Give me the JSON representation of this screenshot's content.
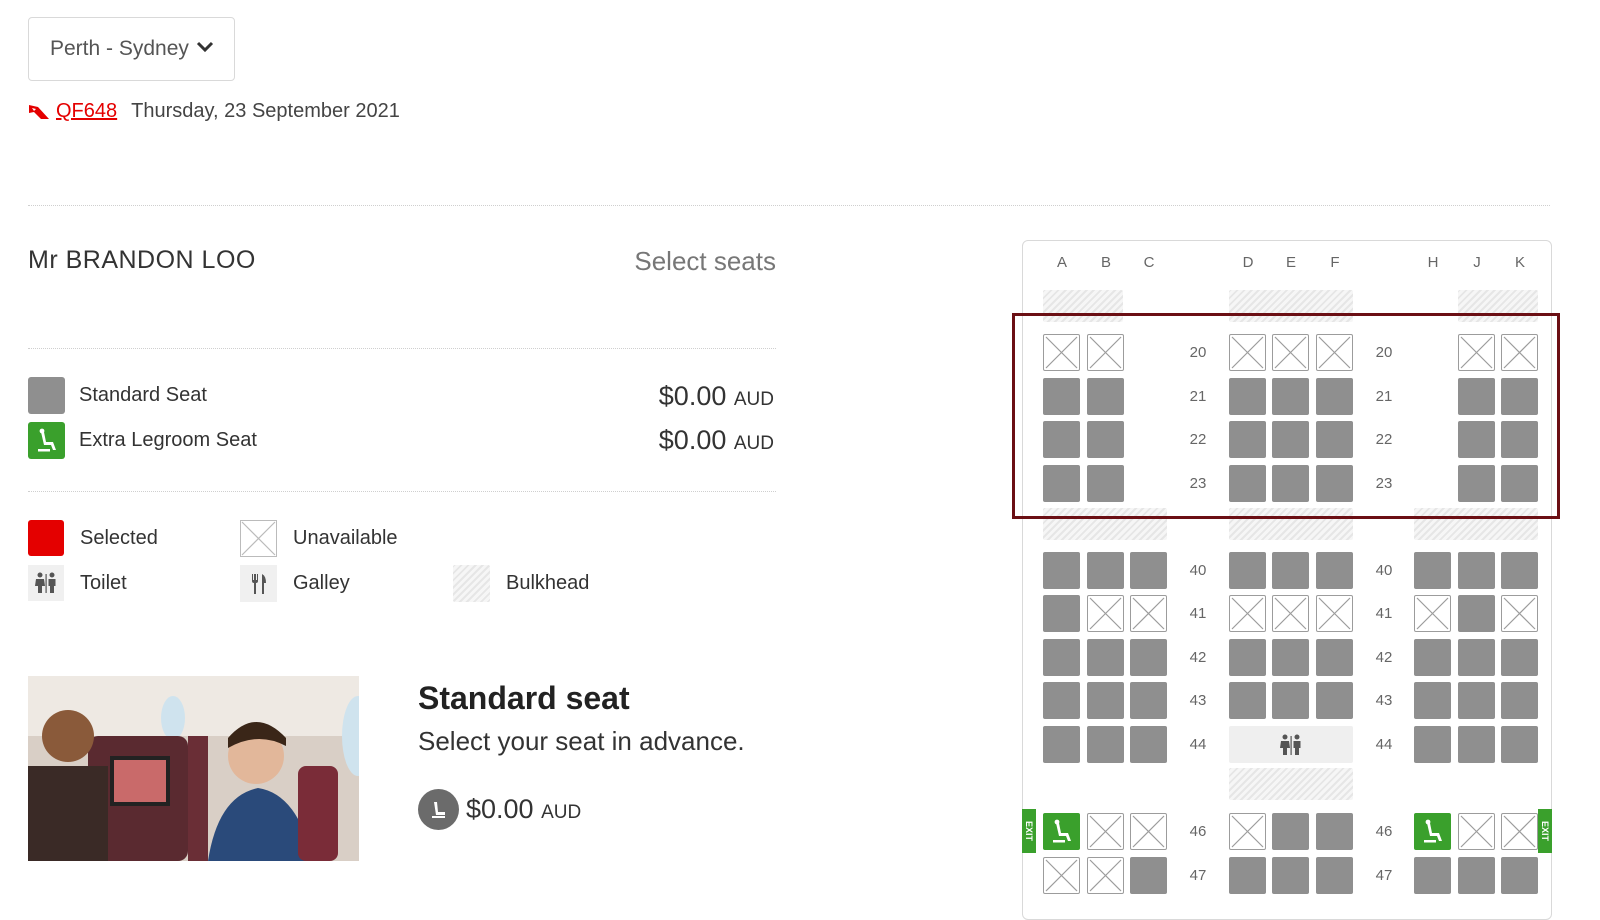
{
  "route": {
    "selected": "Perth - Sydney"
  },
  "flight": {
    "number": "QF648",
    "date": "Thursday, 23 September 2021"
  },
  "passenger": {
    "name": "Mr BRANDON LOO",
    "action_label": "Select seats"
  },
  "seat_types": [
    {
      "label": "Standard Seat",
      "price": "$0.00",
      "currency": "AUD"
    },
    {
      "label": "Extra Legroom Seat",
      "price": "$0.00",
      "currency": "AUD"
    }
  ],
  "legend": {
    "selected": "Selected",
    "unavailable": "Unavailable",
    "toilet": "Toilet",
    "galley": "Galley",
    "bulkhead": "Bulkhead"
  },
  "selected_info": {
    "title": "Standard seat",
    "description": "Select your seat in advance.",
    "price": "$0.00",
    "currency": "AUD"
  },
  "seatmap": {
    "columns": [
      "A",
      "B",
      "C",
      "D",
      "E",
      "F",
      "H",
      "J",
      "K"
    ],
    "exit_label": "EXIT",
    "rows": [
      {
        "num": "20",
        "seats": {
          "A": "na",
          "B": "na",
          "C": "",
          "D": "na",
          "E": "na",
          "F": "na",
          "H": "",
          "J": "na",
          "K": "na"
        }
      },
      {
        "num": "21",
        "seats": {
          "A": "std",
          "B": "std",
          "C": "",
          "D": "std",
          "E": "std",
          "F": "std",
          "H": "",
          "J": "std",
          "K": "std"
        }
      },
      {
        "num": "22",
        "seats": {
          "A": "std",
          "B": "std",
          "C": "",
          "D": "std",
          "E": "std",
          "F": "std",
          "H": "",
          "J": "std",
          "K": "std"
        }
      },
      {
        "num": "23",
        "seats": {
          "A": "std",
          "B": "std",
          "C": "",
          "D": "std",
          "E": "std",
          "F": "std",
          "H": "",
          "J": "std",
          "K": "std"
        }
      },
      {
        "num": "40",
        "seats": {
          "A": "std",
          "B": "std",
          "C": "std",
          "D": "std",
          "E": "std",
          "F": "std",
          "H": "std",
          "J": "std",
          "K": "std"
        }
      },
      {
        "num": "41",
        "seats": {
          "A": "std",
          "B": "na",
          "C": "na",
          "D": "na",
          "E": "na",
          "F": "na",
          "H": "na",
          "J": "std",
          "K": "na"
        }
      },
      {
        "num": "42",
        "seats": {
          "A": "std",
          "B": "std",
          "C": "std",
          "D": "std",
          "E": "std",
          "F": "std",
          "H": "std",
          "J": "std",
          "K": "std"
        }
      },
      {
        "num": "43",
        "seats": {
          "A": "std",
          "B": "std",
          "C": "std",
          "D": "std",
          "E": "std",
          "F": "std",
          "H": "std",
          "J": "std",
          "K": "std"
        }
      },
      {
        "num": "44",
        "seats": {
          "A": "std",
          "B": "std",
          "C": "std",
          "D": "toilet",
          "E": "toilet",
          "F": "toilet",
          "H": "std",
          "J": "std",
          "K": "std"
        }
      },
      {
        "num": "46",
        "seats": {
          "A": "ext",
          "B": "na",
          "C": "na",
          "D": "na",
          "E": "std",
          "F": "std",
          "H": "ext",
          "J": "na",
          "K": "na"
        }
      },
      {
        "num": "47",
        "seats": {
          "A": "na",
          "B": "na",
          "C": "std",
          "D": "std",
          "E": "std",
          "F": "std",
          "H": "std",
          "J": "std",
          "K": "std"
        }
      }
    ]
  }
}
